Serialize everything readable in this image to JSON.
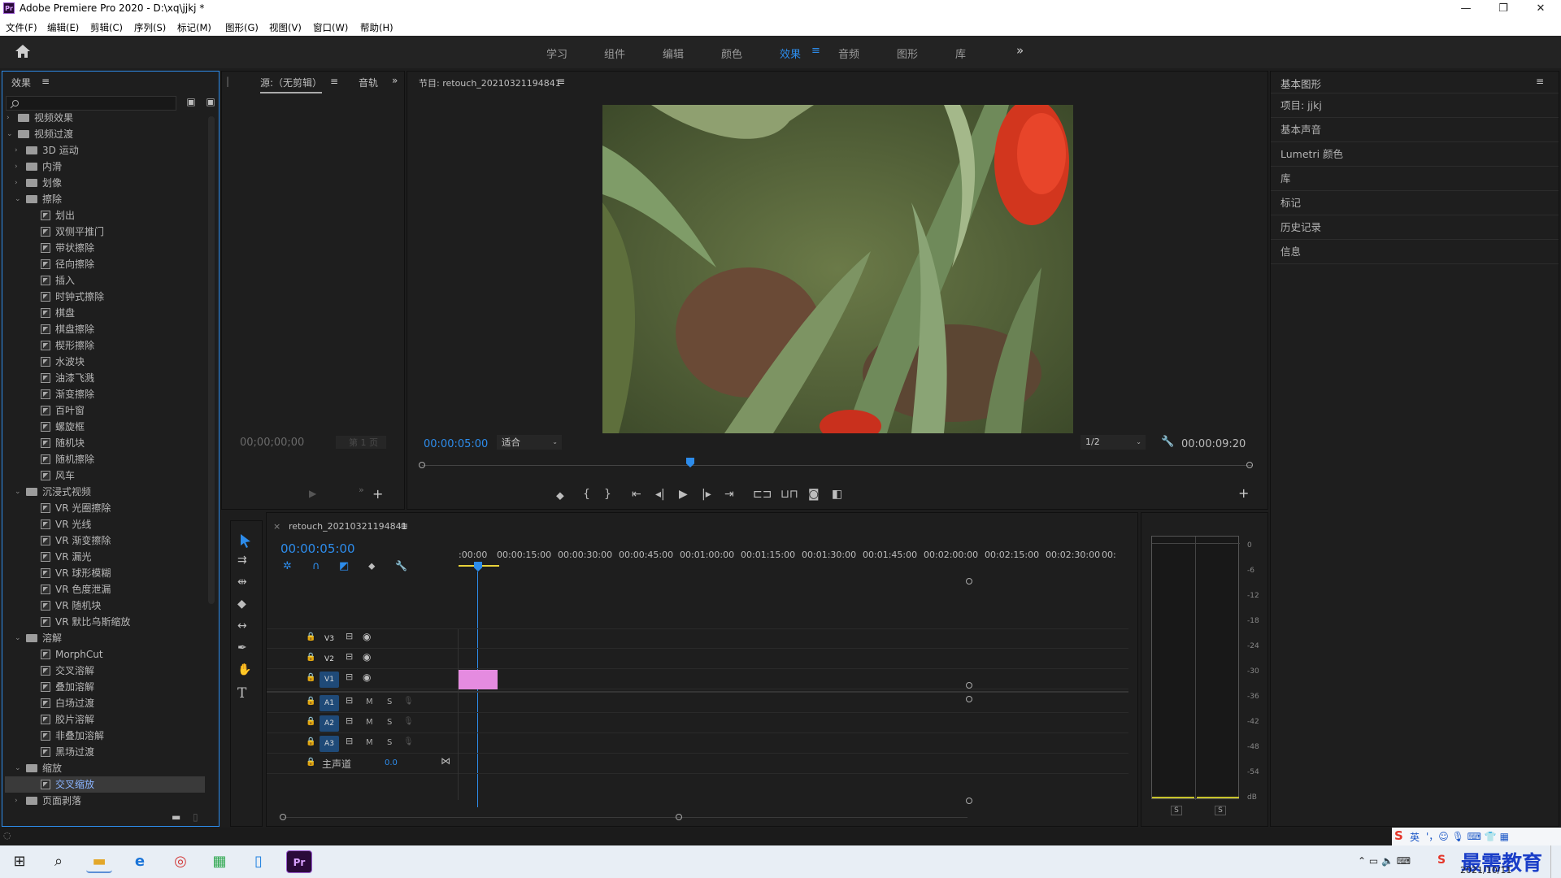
{
  "window": {
    "title": "Adobe Premiere Pro 2020 - D:\\xq\\jjkj *",
    "logo": "Pr",
    "controls": [
      "—",
      "❐",
      "✕"
    ]
  },
  "menu": [
    "文件(F)",
    "编辑(E)",
    "剪辑(C)",
    "序列(S)",
    "标记(M)",
    "图形(G)",
    "视图(V)",
    "窗口(W)",
    "帮助(H)"
  ],
  "workspaces": {
    "items": [
      "学习",
      "组件",
      "编辑",
      "颜色",
      "效果",
      "音频",
      "图形",
      "库"
    ],
    "active": "效果",
    "more": "»"
  },
  "effects": {
    "title": "效果",
    "tree": [
      {
        "label": "视频效果",
        "level": 0,
        "kind": "folder",
        "expanded": false
      },
      {
        "label": "视频过渡",
        "level": 0,
        "kind": "folder",
        "expanded": true
      },
      {
        "label": "3D 运动",
        "level": 1,
        "kind": "folder",
        "expanded": false
      },
      {
        "label": "内滑",
        "level": 1,
        "kind": "folder",
        "expanded": false
      },
      {
        "label": "划像",
        "level": 1,
        "kind": "folder",
        "expanded": false
      },
      {
        "label": "擦除",
        "level": 1,
        "kind": "folder",
        "expanded": true
      },
      {
        "label": "划出",
        "level": 2,
        "kind": "effect"
      },
      {
        "label": "双侧平推门",
        "level": 2,
        "kind": "effect"
      },
      {
        "label": "带状擦除",
        "level": 2,
        "kind": "effect"
      },
      {
        "label": "径向擦除",
        "level": 2,
        "kind": "effect"
      },
      {
        "label": "插入",
        "level": 2,
        "kind": "effect"
      },
      {
        "label": "时钟式擦除",
        "level": 2,
        "kind": "effect"
      },
      {
        "label": "棋盘",
        "level": 2,
        "kind": "effect"
      },
      {
        "label": "棋盘擦除",
        "level": 2,
        "kind": "effect"
      },
      {
        "label": "楔形擦除",
        "level": 2,
        "kind": "effect"
      },
      {
        "label": "水波块",
        "level": 2,
        "kind": "effect"
      },
      {
        "label": "油漆飞溅",
        "level": 2,
        "kind": "effect"
      },
      {
        "label": "渐变擦除",
        "level": 2,
        "kind": "effect"
      },
      {
        "label": "百叶窗",
        "level": 2,
        "kind": "effect"
      },
      {
        "label": "螺旋框",
        "level": 2,
        "kind": "effect"
      },
      {
        "label": "随机块",
        "level": 2,
        "kind": "effect"
      },
      {
        "label": "随机擦除",
        "level": 2,
        "kind": "effect"
      },
      {
        "label": "风车",
        "level": 2,
        "kind": "effect"
      },
      {
        "label": "沉浸式视频",
        "level": 1,
        "kind": "folder",
        "expanded": true
      },
      {
        "label": "VR 光圈擦除",
        "level": 2,
        "kind": "effect"
      },
      {
        "label": "VR 光线",
        "level": 2,
        "kind": "effect"
      },
      {
        "label": "VR 渐变擦除",
        "level": 2,
        "kind": "effect"
      },
      {
        "label": "VR 漏光",
        "level": 2,
        "kind": "effect"
      },
      {
        "label": "VR 球形模糊",
        "level": 2,
        "kind": "effect"
      },
      {
        "label": "VR 色度泄漏",
        "level": 2,
        "kind": "effect"
      },
      {
        "label": "VR 随机块",
        "level": 2,
        "kind": "effect"
      },
      {
        "label": "VR 默比乌斯缩放",
        "level": 2,
        "kind": "effect"
      },
      {
        "label": "溶解",
        "level": 1,
        "kind": "folder",
        "expanded": true
      },
      {
        "label": "MorphCut",
        "level": 2,
        "kind": "effect"
      },
      {
        "label": "交叉溶解",
        "level": 2,
        "kind": "effect"
      },
      {
        "label": "叠加溶解",
        "level": 2,
        "kind": "effect"
      },
      {
        "label": "白场过渡",
        "level": 2,
        "kind": "effect"
      },
      {
        "label": "胶片溶解",
        "level": 2,
        "kind": "effect"
      },
      {
        "label": "非叠加溶解",
        "level": 2,
        "kind": "effect"
      },
      {
        "label": "黑场过渡",
        "level": 2,
        "kind": "effect"
      },
      {
        "label": "缩放",
        "level": 1,
        "kind": "folder",
        "expanded": true
      },
      {
        "label": "交叉缩放",
        "level": 2,
        "kind": "effect",
        "selected": true
      },
      {
        "label": "页面剥落",
        "level": 1,
        "kind": "folder",
        "expanded": false
      }
    ]
  },
  "source": {
    "tab": "源:（无剪辑）",
    "tab2": "音轨",
    "timecode": "00;00;00;00",
    "page": "第 1 页"
  },
  "program": {
    "title": "节目: retouch_20210321194841",
    "timecode": "00:00:05:00",
    "fit": "适合",
    "res": "1/2",
    "duration": "00:00:09:20"
  },
  "timeline": {
    "tab": "retouch_20210321194841",
    "timecode": "00:00:05:00",
    "ruler": [
      ":00:00",
      "00:00:15:00",
      "00:00:30:00",
      "00:00:45:00",
      "00:01:00:00",
      "00:01:15:00",
      "00:01:30:00",
      "00:01:45:00",
      "00:02:00:00",
      "00:02:15:00",
      "00:02:30:00",
      "00:"
    ],
    "video_tracks": [
      "V3",
      "V2",
      "V1"
    ],
    "audio_tracks": [
      "A1",
      "A2",
      "A3"
    ],
    "master": {
      "label": "主声道",
      "value": "0.0"
    },
    "mute": "M",
    "solo": "S"
  },
  "meter": {
    "scale": [
      "0",
      "-6",
      "-12",
      "-18",
      "-24",
      "-30",
      "-36",
      "-42",
      "-48",
      "-54",
      "dB"
    ],
    "solo": [
      "S",
      "S"
    ]
  },
  "right_panel": {
    "title": "基本图形",
    "items": [
      "项目: jjkj",
      "基本声音",
      "Lumetri 颜色",
      "库",
      "标记",
      "历史记录",
      "信息"
    ]
  },
  "taskbar": {
    "date": "2021/10/11",
    "ime": "英",
    "watermark": "最需教育"
  },
  "colors": {
    "accent": "#2d8ceb",
    "clip": "#e58be0",
    "track_on": "#1f4a78"
  }
}
